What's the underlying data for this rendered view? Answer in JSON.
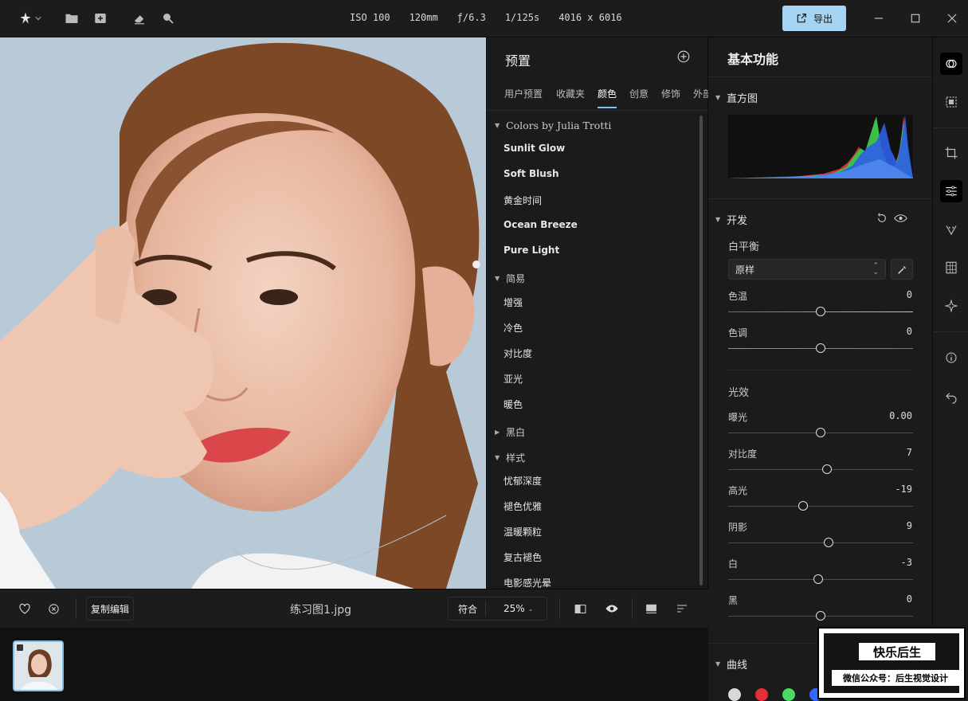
{
  "camera_meta": {
    "iso": "ISO 100",
    "focal": "120mm",
    "aperture": "ƒ/6.3",
    "shutter": "1/125s",
    "resolution": "4016 x 6016"
  },
  "toolbar": {
    "export_label": "导出"
  },
  "presets": {
    "title": "预置",
    "tabs": [
      "用户预置",
      "收藏夹",
      "颜色",
      "创意",
      "修饰",
      "外部"
    ],
    "active_tab": "颜色",
    "groups": [
      {
        "name": "Colors by Julia Trotti",
        "expanded": true,
        "items": [
          "Sunlit Glow",
          "Soft Blush",
          "黄金时间",
          "Ocean Breeze",
          "Pure Light"
        ]
      },
      {
        "name": "简易",
        "expanded": true,
        "items": [
          "增强",
          "冷色",
          "对比度",
          "亚光",
          "暖色"
        ]
      },
      {
        "name": "黑白",
        "expanded": false,
        "items": []
      },
      {
        "name": "样式",
        "expanded": true,
        "items": [
          "忧郁深度",
          "褪色优雅",
          "温暖颗粒",
          "复古褪色",
          "电影感光晕"
        ]
      }
    ]
  },
  "bottom": {
    "copy_edit": "复制编辑",
    "filename": "练习图1.jpg",
    "fit": "符合",
    "zoom": "25%"
  },
  "basic": {
    "title": "基本功能",
    "histogram_label": "直方图",
    "develop_label": "开发",
    "white_balance_label": "白平衡",
    "wb_value": "原样",
    "light_label": "光效",
    "curves_label": "曲线",
    "sliders": [
      {
        "name": "色温",
        "value": "0",
        "pos": 0.5
      },
      {
        "name": "色调",
        "value": "0",
        "pos": 0.5
      },
      {
        "name": "曝光",
        "value": "0.00",
        "pos": 0.5
      },
      {
        "name": "对比度",
        "value": "7",
        "pos": 0.535
      },
      {
        "name": "高光",
        "value": "-19",
        "pos": 0.405
      },
      {
        "name": "阴影",
        "value": "9",
        "pos": 0.545
      },
      {
        "name": "白",
        "value": "-3",
        "pos": 0.485
      },
      {
        "name": "黑",
        "value": "0",
        "pos": 0.5
      }
    ],
    "curve_colors": [
      "#d8d8d8",
      "#e5303a",
      "#4cd964",
      "#2f6bff"
    ]
  },
  "watermark": {
    "line1": "快乐后生",
    "line2": "微信公众号：后生视觉设计"
  }
}
